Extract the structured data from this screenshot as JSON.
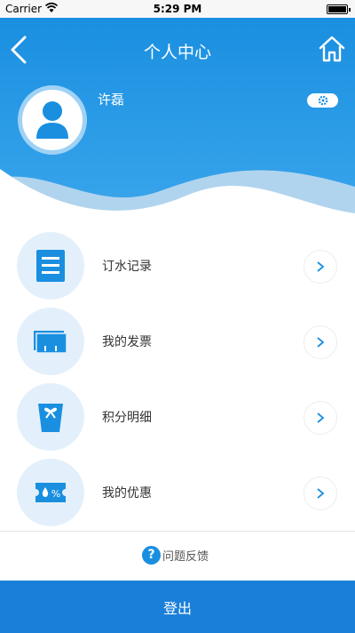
{
  "status_bar": {
    "carrier": "Carrier",
    "time": "5:29 PM"
  },
  "nav": {
    "title": "个人中心",
    "back_icon": "chevron-left-icon",
    "home_icon": "home-icon"
  },
  "profile": {
    "username": "许磊",
    "settings_icon": "gear-icon"
  },
  "menu": [
    {
      "label": "订水记录",
      "icon": "order-record-icon"
    },
    {
      "label": "我的发票",
      "icon": "invoice-icon"
    },
    {
      "label": "积分明细",
      "icon": "points-gift-icon"
    },
    {
      "label": "我的优惠",
      "icon": "coupon-icon"
    }
  ],
  "feedback": {
    "label": "问题反馈",
    "icon_glyph": "?"
  },
  "logout": {
    "label": "登出"
  },
  "colors": {
    "primary": "#1a8fe0",
    "logout_bg": "#1a7fd8",
    "icon_circle_bg": "#e3f0fb"
  }
}
